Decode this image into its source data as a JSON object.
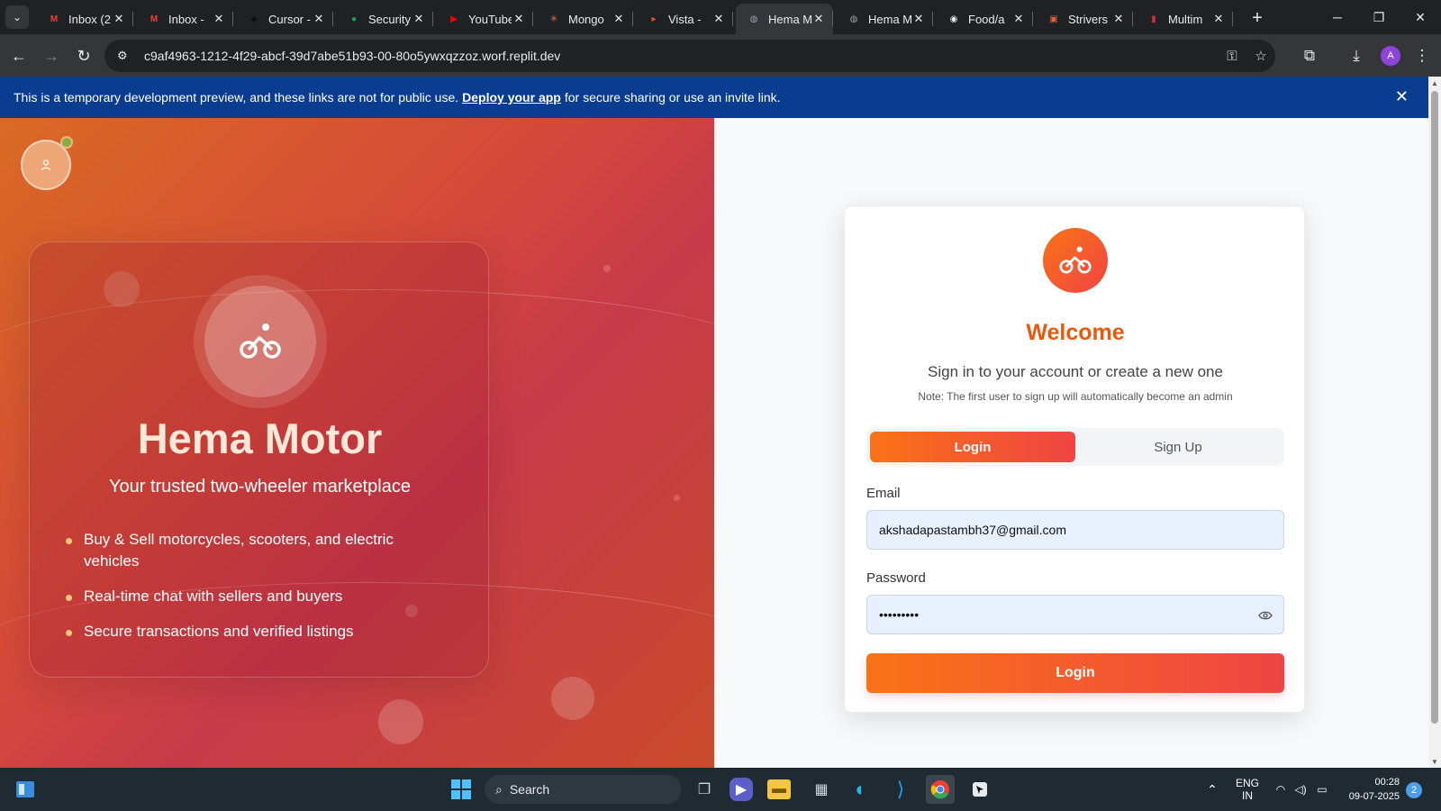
{
  "browser": {
    "tabs": [
      {
        "title": "Inbox (2",
        "icon": "gmail-icon",
        "color": "#ea4335"
      },
      {
        "title": "Inbox -",
        "icon": "gmail-icon",
        "color": "#ea4335"
      },
      {
        "title": "Cursor -",
        "icon": "cursor-icon",
        "color": "#111111"
      },
      {
        "title": "Security",
        "icon": "mongodb-leaf-icon",
        "color": "#13aa52"
      },
      {
        "title": "YouTube",
        "icon": "youtube-icon",
        "color": "#ff0000"
      },
      {
        "title": "Mongo",
        "icon": "claude-icon",
        "color": "#d97757"
      },
      {
        "title": "Vista -",
        "icon": "vista-icon",
        "color": "#f15a24"
      },
      {
        "title": "Hema M",
        "icon": "globe-icon",
        "color": "#9aa0a6"
      },
      {
        "title": "Hema M",
        "icon": "globe-icon",
        "color": "#9aa0a6"
      },
      {
        "title": "Food/a",
        "icon": "github-icon",
        "color": "#e8eaed"
      },
      {
        "title": "Strivers",
        "icon": "striver-icon",
        "color": "#e35d3d"
      },
      {
        "title": "Multim",
        "icon": "multi-icon",
        "color": "#d32f2f"
      }
    ],
    "active_tab_index": 7,
    "url": "c9af4963-1212-4f29-abcf-39d7abe51b93-00-80o5ywxqzzoz.worf.replit.dev",
    "profile_initial": "A"
  },
  "banner": {
    "text_before": "This is a temporary development preview, and these links are not for public use.",
    "link": "Deploy your app",
    "text_after": "for secure sharing or use an invite link."
  },
  "hero": {
    "brand": "Hema Motor",
    "tagline": "Your trusted two-wheeler marketplace",
    "features": [
      "Buy & Sell motorcycles, scooters, and electric vehicles",
      "Real-time chat with sellers and buyers",
      "Secure transactions and verified listings"
    ]
  },
  "auth": {
    "welcome": "Welcome",
    "subtitle": "Sign in to your account or create a new one",
    "note": "Note: The first user to sign up will automatically become an admin",
    "tab_login": "Login",
    "tab_signup": "Sign Up",
    "email_label": "Email",
    "email_value": "akshadapastambh37@gmail.com",
    "password_label": "Password",
    "password_value": "•••••••••",
    "submit": "Login"
  },
  "taskbar": {
    "search": "Search",
    "lang_top": "ENG",
    "lang_bottom": "IN",
    "time": "00:28",
    "date": "09-07-2025",
    "notifications": "2"
  }
}
